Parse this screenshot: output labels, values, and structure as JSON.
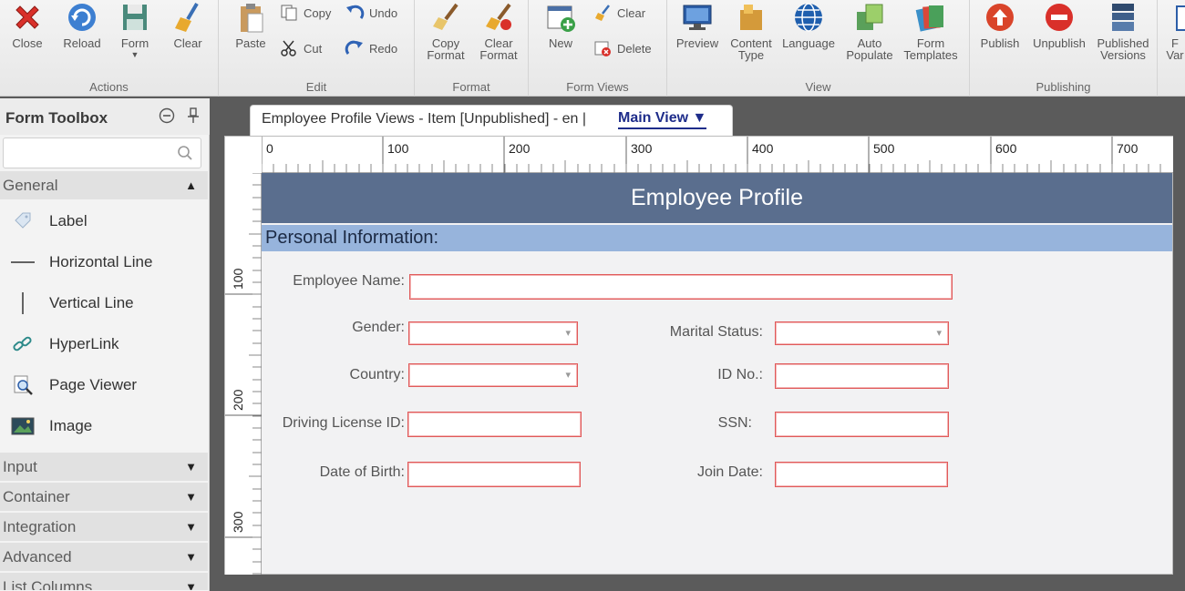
{
  "ribbon": {
    "groups": {
      "actions": "Actions",
      "edit": "Edit",
      "format": "Format",
      "form_views": "Form Views",
      "view": "View",
      "publishing": "Publishing"
    },
    "buttons": {
      "close": "Close",
      "reload": "Reload",
      "form": "Form",
      "clear": "Clear",
      "paste": "Paste",
      "copy": "Copy",
      "cut": "Cut",
      "undo": "Undo",
      "redo": "Redo",
      "copy_format": "Copy\nFormat",
      "clear_format": "Clear\nFormat",
      "new": "New",
      "view_clear": "Clear",
      "delete": "Delete",
      "preview": "Preview",
      "content_type": "Content\nType",
      "language": "Language",
      "auto_populate": "Auto\nPopulate",
      "form_templates": "Form\nTemplates",
      "publish": "Publish",
      "unpublish": "Unpublish",
      "published_versions": "Published\nVersions",
      "form_variables_partial": "F\nVar"
    }
  },
  "toolbox": {
    "title": "Form Toolbox",
    "search_placeholder": "",
    "general": "General",
    "tools": {
      "label": "Label",
      "horizontal_line": "Horizontal Line",
      "vertical_line": "Vertical Line",
      "hyperlink": "HyperLink",
      "page_viewer": "Page Viewer",
      "image": "Image"
    },
    "categories": {
      "input": "Input",
      "container": "Container",
      "integration": "Integration",
      "advanced": "Advanced",
      "list_columns": "List Columns"
    }
  },
  "document": {
    "tab_title": "Employee Profile Views - Item [Unpublished] - en |",
    "view_selector": "Main View ▼"
  },
  "ruler": {
    "top": [
      "0",
      "100",
      "200",
      "300",
      "400",
      "500",
      "600",
      "700"
    ],
    "left": [
      "100",
      "200",
      "300"
    ]
  },
  "form": {
    "header": "Employee Profile",
    "section": "Personal Information:",
    "labels": {
      "employee_name": "Employee Name:",
      "gender": "Gender:",
      "marital_status": "Marital Status:",
      "country": "Country:",
      "id_no": "ID No.:",
      "driving_license": "Driving License ID:",
      "ssn": "SSN:",
      "date_of_birth": "Date of Birth:",
      "join_date": "Join Date:"
    }
  },
  "colors": {
    "form_header": "#5a6e8e",
    "section_bar": "#97b4dc",
    "field_border": "#e05a5a",
    "view_link": "#1e2c8a"
  }
}
